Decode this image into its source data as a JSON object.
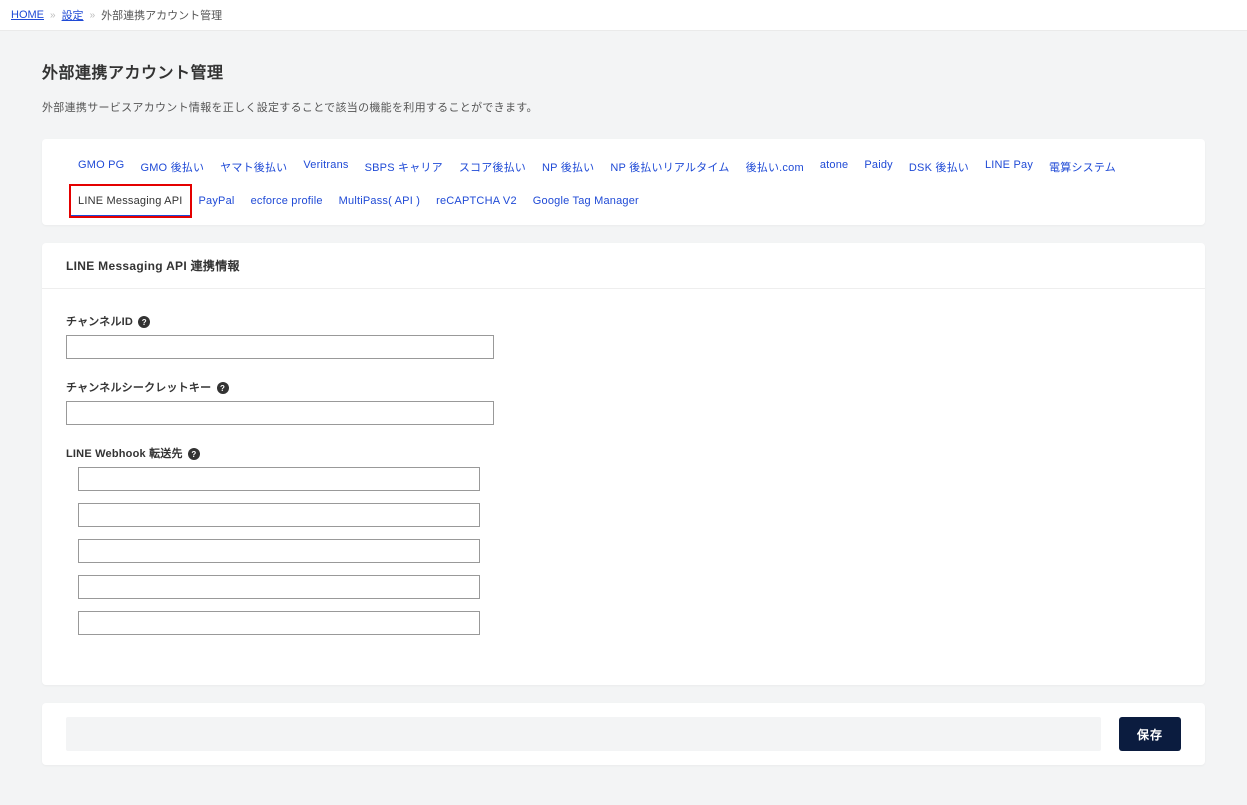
{
  "breadcrumb": {
    "home": "HOME",
    "settings": "設定",
    "current": "外部連携アカウント管理"
  },
  "page": {
    "title": "外部連携アカウント管理",
    "description": "外部連携サービスアカウント情報を正しく設定することで該当の機能を利用することができます。"
  },
  "tabs": [
    {
      "id": "gmo-pg",
      "label": "GMO PG",
      "active": false
    },
    {
      "id": "gmo-atobarai",
      "label": "GMO 後払い",
      "active": false
    },
    {
      "id": "yamato",
      "label": "ヤマト後払い",
      "active": false
    },
    {
      "id": "veritrans",
      "label": "Veritrans",
      "active": false
    },
    {
      "id": "sbps",
      "label": "SBPS キャリア",
      "active": false
    },
    {
      "id": "score",
      "label": "スコア後払い",
      "active": false
    },
    {
      "id": "np",
      "label": "NP 後払い",
      "active": false
    },
    {
      "id": "np-real",
      "label": "NP 後払いリアルタイム",
      "active": false
    },
    {
      "id": "atobarai-com",
      "label": "後払い.com",
      "active": false
    },
    {
      "id": "atone",
      "label": "atone",
      "active": false
    },
    {
      "id": "paidy",
      "label": "Paidy",
      "active": false
    },
    {
      "id": "dsk",
      "label": "DSK 後払い",
      "active": false
    },
    {
      "id": "linepay",
      "label": "LINE Pay",
      "active": false
    },
    {
      "id": "densan",
      "label": "電算システム",
      "active": false
    },
    {
      "id": "line-msg",
      "label": "LINE Messaging API",
      "active": true,
      "highlight": true
    },
    {
      "id": "paypal",
      "label": "PayPal",
      "active": false
    },
    {
      "id": "ecforce",
      "label": "ecforce profile",
      "active": false
    },
    {
      "id": "multipass",
      "label": "MultiPass( API )",
      "active": false
    },
    {
      "id": "recaptcha",
      "label": "reCAPTCHA V2",
      "active": false
    },
    {
      "id": "gtm",
      "label": "Google Tag Manager",
      "active": false
    }
  ],
  "section": {
    "header": "LINE Messaging API 連携情報"
  },
  "form": {
    "channel_id_label": "チャンネルID",
    "channel_id_value": "",
    "channel_secret_label": "チャンネルシークレットキー",
    "channel_secret_value": "",
    "webhook_label": "LINE Webhook 転送先",
    "webhook_values": [
      "",
      "",
      "",
      "",
      ""
    ]
  },
  "footer": {
    "save_label": "保存"
  }
}
